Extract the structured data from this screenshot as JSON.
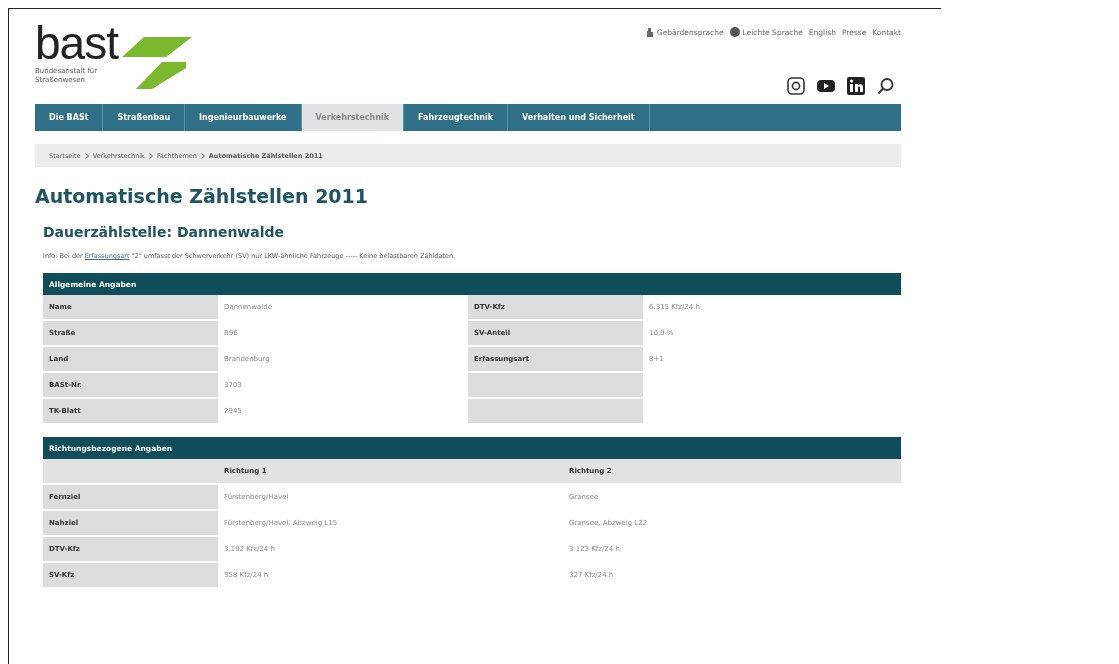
{
  "header": {
    "logo_text": "bast",
    "logo_subtitle": "Bundesanstalt für Straßenwesen",
    "service_links": [
      {
        "kind": "sign",
        "label": "Gebärdensprache"
      },
      {
        "kind": "easy",
        "label": "Leichte Sprache"
      },
      {
        "kind": "plain",
        "label": "English"
      },
      {
        "kind": "plain",
        "label": "Presse"
      },
      {
        "kind": "plain",
        "label": "Kontakt"
      }
    ]
  },
  "nav": [
    {
      "label": "Die BASt",
      "selected": false
    },
    {
      "label": "Straßenbau",
      "selected": false
    },
    {
      "label": "Ingenieurbauwerke",
      "selected": false
    },
    {
      "label": "Verkehrstechnik",
      "selected": true
    },
    {
      "label": "Fahrzeugtechnik",
      "selected": false
    },
    {
      "label": "Verhalten und Sicherheit",
      "selected": false
    }
  ],
  "breadcrumb": [
    "Startseite",
    "Verkehrstechnik",
    "Fachthemen",
    "Automatische Zählstellen 2011"
  ],
  "title": "Automatische Zählstellen 2011",
  "subtitle": "Dauerzählstelle: Dannenwalde",
  "info": {
    "before": "Info: Bei der ",
    "link": "Erfassungsart",
    "after": " \"2\" umfasst der Schwerverkehr (SV) nur LKW-ähnliche Fahrzeuge ----- Keine belastbaren Zähldaten."
  },
  "general": {
    "title": "Allgemeine Angaben",
    "left": [
      {
        "label": "Name",
        "value": "Dannenwalde"
      },
      {
        "label": "Straße",
        "value": "B96"
      },
      {
        "label": "Land",
        "value": "Brandenburg"
      },
      {
        "label": "BASt-Nr.",
        "value": "3703"
      },
      {
        "label": "TK-Blatt",
        "value": "2945"
      }
    ],
    "right": [
      {
        "label": "DTV-Kfz",
        "value": "6.315 Kfz/24 h"
      },
      {
        "label": "SV-Anteil",
        "value": "10,9 %"
      },
      {
        "label": "Erfassungsart",
        "value": "8+1"
      }
    ]
  },
  "directional": {
    "title": "Richtungsbezogene Angaben",
    "columns": [
      "Richtung 1",
      "Richtung 2"
    ],
    "rows": [
      {
        "label": "Fernziel",
        "values": [
          "Fürstenberg/Havel",
          "Gransee"
        ]
      },
      {
        "label": "Nahziel",
        "values": [
          "Fürstenberg/Havel, Abzweig L15",
          "Gransee, Abzweig L22"
        ]
      },
      {
        "label": "DTV-Kfz",
        "values": [
          "3.192 Kfz/24 h",
          "3.123 Kfz/24 h"
        ]
      },
      {
        "label": "SV-Kfz",
        "values": [
          "358 Kfz/24 h",
          "327 Kfz/24 h"
        ]
      }
    ]
  }
}
